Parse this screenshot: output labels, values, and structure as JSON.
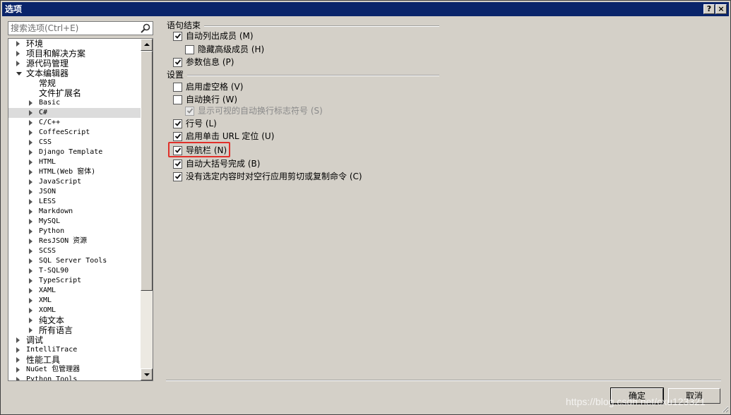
{
  "window": {
    "title": "选项",
    "help_glyph": "?",
    "close_glyph": "×"
  },
  "search": {
    "placeholder": "搜索选项(Ctrl+E)"
  },
  "tree": [
    {
      "label": "环境",
      "level": 0,
      "arrow": "closed",
      "mono": false,
      "selected": false
    },
    {
      "label": "项目和解决方案",
      "level": 0,
      "arrow": "closed",
      "mono": false,
      "selected": false
    },
    {
      "label": "源代码管理",
      "level": 0,
      "arrow": "closed",
      "mono": false,
      "selected": false
    },
    {
      "label": "文本编辑器",
      "level": 0,
      "arrow": "open",
      "mono": false,
      "selected": false
    },
    {
      "label": "常规",
      "level": 1,
      "arrow": "none",
      "mono": false,
      "selected": false
    },
    {
      "label": "文件扩展名",
      "level": 1,
      "arrow": "none",
      "mono": false,
      "selected": false
    },
    {
      "label": "Basic",
      "level": 1,
      "arrow": "closed",
      "mono": true,
      "selected": false
    },
    {
      "label": "C#",
      "level": 1,
      "arrow": "closed",
      "mono": true,
      "selected": true
    },
    {
      "label": "C/C++",
      "level": 1,
      "arrow": "closed",
      "mono": true,
      "selected": false
    },
    {
      "label": "CoffeeScript",
      "level": 1,
      "arrow": "closed",
      "mono": true,
      "selected": false
    },
    {
      "label": "CSS",
      "level": 1,
      "arrow": "closed",
      "mono": true,
      "selected": false
    },
    {
      "label": "Django Template",
      "level": 1,
      "arrow": "closed",
      "mono": true,
      "selected": false
    },
    {
      "label": "HTML",
      "level": 1,
      "arrow": "closed",
      "mono": true,
      "selected": false
    },
    {
      "label": "HTML(Web 窗体)",
      "level": 1,
      "arrow": "closed",
      "mono": true,
      "selected": false
    },
    {
      "label": "JavaScript",
      "level": 1,
      "arrow": "closed",
      "mono": true,
      "selected": false
    },
    {
      "label": "JSON",
      "level": 1,
      "arrow": "closed",
      "mono": true,
      "selected": false
    },
    {
      "label": "LESS",
      "level": 1,
      "arrow": "closed",
      "mono": true,
      "selected": false
    },
    {
      "label": "Markdown",
      "level": 1,
      "arrow": "closed",
      "mono": true,
      "selected": false
    },
    {
      "label": "MySQL",
      "level": 1,
      "arrow": "closed",
      "mono": true,
      "selected": false
    },
    {
      "label": "Python",
      "level": 1,
      "arrow": "closed",
      "mono": true,
      "selected": false
    },
    {
      "label": "ResJSON 资源",
      "level": 1,
      "arrow": "closed",
      "mono": true,
      "selected": false
    },
    {
      "label": "SCSS",
      "level": 1,
      "arrow": "closed",
      "mono": true,
      "selected": false
    },
    {
      "label": "SQL Server Tools",
      "level": 1,
      "arrow": "closed",
      "mono": true,
      "selected": false
    },
    {
      "label": "T-SQL90",
      "level": 1,
      "arrow": "closed",
      "mono": true,
      "selected": false
    },
    {
      "label": "TypeScript",
      "level": 1,
      "arrow": "closed",
      "mono": true,
      "selected": false
    },
    {
      "label": "XAML",
      "level": 1,
      "arrow": "closed",
      "mono": true,
      "selected": false
    },
    {
      "label": "XML",
      "level": 1,
      "arrow": "closed",
      "mono": true,
      "selected": false
    },
    {
      "label": "XOML",
      "level": 1,
      "arrow": "closed",
      "mono": true,
      "selected": false
    },
    {
      "label": "纯文本",
      "level": 1,
      "arrow": "closed",
      "mono": false,
      "selected": false
    },
    {
      "label": "所有语言",
      "level": 1,
      "arrow": "closed",
      "mono": false,
      "selected": false
    },
    {
      "label": "调试",
      "level": 0,
      "arrow": "closed",
      "mono": false,
      "selected": false
    },
    {
      "label": "IntelliTrace",
      "level": 0,
      "arrow": "closed",
      "mono": true,
      "selected": false
    },
    {
      "label": "性能工具",
      "level": 0,
      "arrow": "closed",
      "mono": false,
      "selected": false
    },
    {
      "label": "NuGet 包管理器",
      "level": 0,
      "arrow": "closed",
      "mono": true,
      "selected": false
    },
    {
      "label": "Python Tools",
      "level": 0,
      "arrow": "closed",
      "mono": true,
      "selected": false
    }
  ],
  "groups": {
    "statement_completion": {
      "title": "语句结束",
      "options": {
        "auto_list_members": {
          "label": "自动列出成员 (M)",
          "checked": true,
          "disabled": false
        },
        "hide_advanced": {
          "label": "隐藏高级成员 (H)",
          "checked": false,
          "disabled": false
        },
        "param_info": {
          "label": "参数信息 (P)",
          "checked": true,
          "disabled": false
        }
      }
    },
    "settings": {
      "title": "设置",
      "options": {
        "virtual_space": {
          "label": "启用虚空格 (V)",
          "checked": false,
          "disabled": false
        },
        "word_wrap": {
          "label": "自动换行 (W)",
          "checked": false,
          "disabled": false
        },
        "wrap_glyphs": {
          "label": "显示可视的自动换行标志符号 (S)",
          "checked": true,
          "disabled": true
        },
        "line_numbers": {
          "label": "行号 (L)",
          "checked": true,
          "disabled": false
        },
        "single_click_url": {
          "label": "启用单击 URL 定位 (U)",
          "checked": true,
          "disabled": false
        },
        "navigation_bar": {
          "label": "导航栏 (N)",
          "checked": true,
          "disabled": false
        },
        "brace_completion": {
          "label": "自动大括号完成 (B)",
          "checked": true,
          "disabled": false
        },
        "copy_blank_line": {
          "label": "没有选定内容时对空行应用剪切或复制命令 (C)",
          "checked": true,
          "disabled": false
        }
      }
    }
  },
  "buttons": {
    "ok": "确定",
    "cancel": "取消"
  },
  "watermark": "https://blog.csdn.net/cxu123321",
  "colors": {
    "titlebar": "#0a246a",
    "highlight": "#e0302a",
    "selected_row": "#dcdcdc"
  }
}
